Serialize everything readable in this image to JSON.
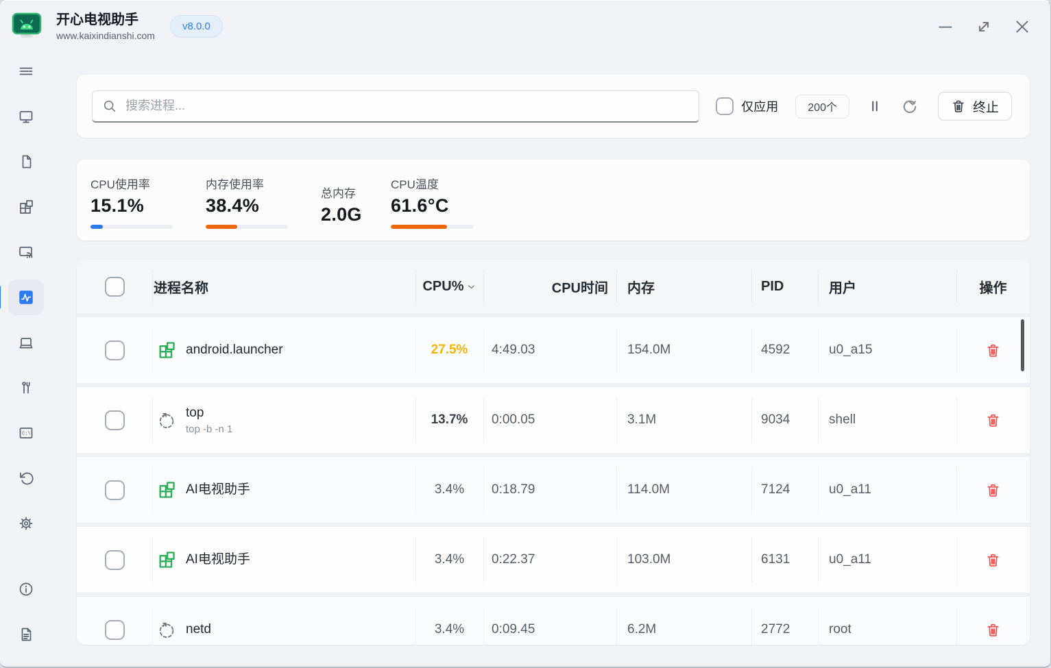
{
  "window": {
    "app_title": "开心电视助手",
    "app_url": "www.kaixindianshi.com",
    "version_badge": "v8.0.0"
  },
  "sidebar": {
    "active_item": "task-monitor",
    "items": [
      "menu",
      "tv-screen",
      "apps-folder",
      "app-grid",
      "screen-cast",
      "task-monitor",
      "device",
      "toolbox",
      "terminal",
      "history",
      "settings",
      "about",
      "logs"
    ]
  },
  "toolbar": {
    "search_placeholder": "搜索进程...",
    "only_apps_label": "仅应用",
    "process_count": "200个",
    "terminate_label": "终止"
  },
  "stats": {
    "cards": [
      {
        "label": "CPU使用率",
        "value": "15.1%",
        "bar_percent": 15,
        "bar_color": "#2b7af0"
      },
      {
        "label": "内存使用率",
        "value": "38.4%",
        "bar_percent": 38,
        "bar_color": "#f0660a"
      },
      {
        "label": "总内存",
        "value": "2.0G",
        "bar_percent": null,
        "bar_color": null
      },
      {
        "label": "CPU温度",
        "value": "61.6°C",
        "bar_percent": 68,
        "bar_color": "#f0660a"
      }
    ]
  },
  "table": {
    "headers": {
      "name": "进程名称",
      "cpu": "CPU%",
      "time": "CPU时间",
      "memory": "内存",
      "pid": "PID",
      "user": "用户",
      "actions": "操作"
    },
    "sort_column": "cpu",
    "rows": [
      {
        "name": "android.launcher",
        "subtitle": "",
        "icon": "app-window",
        "cpu": "27.5%",
        "cpu_color": "#f2b50d",
        "cpu_bold": true,
        "time": "4:49.03",
        "memory": "154.0M",
        "pid": "4592",
        "user": "u0_a15"
      },
      {
        "name": "top",
        "subtitle": "top -b -n 1",
        "icon": "process",
        "cpu": "13.7%",
        "cpu_color": "#3c424a",
        "cpu_bold": true,
        "time": "0:00.05",
        "memory": "3.1M",
        "pid": "9034",
        "user": "shell"
      },
      {
        "name": "AI电视助手",
        "subtitle": "",
        "icon": "app-window",
        "cpu": "3.4%",
        "cpu_color": "#565c64",
        "cpu_bold": false,
        "time": "0:18.79",
        "memory": "114.0M",
        "pid": "7124",
        "user": "u0_a11"
      },
      {
        "name": "AI电视助手",
        "subtitle": "",
        "icon": "app-window",
        "cpu": "3.4%",
        "cpu_color": "#565c64",
        "cpu_bold": false,
        "time": "0:22.37",
        "memory": "103.0M",
        "pid": "6131",
        "user": "u0_a11"
      },
      {
        "name": "netd",
        "subtitle": "",
        "icon": "process",
        "cpu": "3.4%",
        "cpu_color": "#565c64",
        "cpu_bold": false,
        "time": "0:09.45",
        "memory": "6.2M",
        "pid": "2772",
        "user": "root"
      }
    ]
  }
}
